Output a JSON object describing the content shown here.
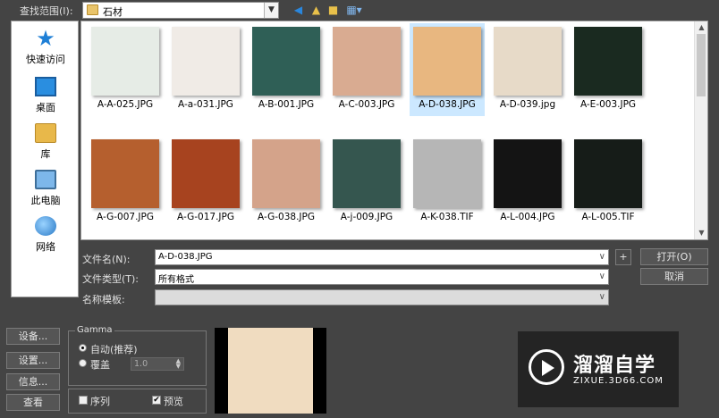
{
  "toolbar": {
    "lookin_label": "查找范围(I):",
    "lookin_value": "石材",
    "icons": [
      "back-icon",
      "up-folder-icon",
      "new-folder-icon",
      "view-menu-icon"
    ]
  },
  "places": [
    {
      "label": "快速访问",
      "icon": "star-icon"
    },
    {
      "label": "桌面",
      "icon": "desktop-icon"
    },
    {
      "label": "库",
      "icon": "library-icon"
    },
    {
      "label": "此电脑",
      "icon": "computer-icon"
    },
    {
      "label": "网络",
      "icon": "network-icon"
    }
  ],
  "files": [
    {
      "name": "A-A-025.JPG",
      "color": "#e6ece6",
      "selected": false
    },
    {
      "name": "A-a-031.JPG",
      "color": "#f0ebe6",
      "selected": false
    },
    {
      "name": "A-B-001.JPG",
      "color": "#2f5f56",
      "selected": false
    },
    {
      "name": "A-C-003.JPG",
      "color": "#d9ab91",
      "selected": false
    },
    {
      "name": "A-D-038.JPG",
      "color": "#e8b780",
      "selected": true
    },
    {
      "name": "A-D-039.jpg",
      "color": "#e7dac8",
      "selected": false
    },
    {
      "name": "A-E-003.JPG",
      "color": "#1a2a20",
      "selected": false
    },
    {
      "name": "A-G-007.JPG",
      "color": "#b55f2e",
      "selected": false
    },
    {
      "name": "A-G-017.JPG",
      "color": "#a7431f",
      "selected": false
    },
    {
      "name": "A-G-038.JPG",
      "color": "#d4a38a",
      "selected": false
    },
    {
      "name": "A-j-009.JPG",
      "color": "#35564f",
      "selected": false
    },
    {
      "name": "A-K-038.TIF",
      "color": "#b6b6b6",
      "selected": false
    },
    {
      "name": "A-L-004.JPG",
      "color": "#141414",
      "selected": false
    },
    {
      "name": "A-L-005.TIF",
      "color": "#161c18",
      "selected": false
    }
  ],
  "form": {
    "filename_label": "文件名(N):",
    "filename_value": "A-D-038.JPG",
    "filetype_label": "文件类型(T):",
    "filetype_value": "所有格式",
    "template_label": "名称模板:",
    "template_value": "",
    "plus_label": "+",
    "open_label": "打开(O)",
    "cancel_label": "取消"
  },
  "side_buttons": {
    "setup": "设备...",
    "settings": "设置...",
    "info": "信息...",
    "view": "查看"
  },
  "gamma": {
    "title": "Gamma",
    "auto_label": "自动(推荐)",
    "override_label": "覆盖",
    "override_value": "1.0",
    "auto_selected": true
  },
  "options": {
    "sequence_label": "序列",
    "sequence_checked": false,
    "preview_label": "预览",
    "preview_checked": true
  },
  "preview": {
    "color": "#f0dcc0"
  },
  "watermark": {
    "title": "溜溜自学",
    "url": "ZIXUE.3D66.COM"
  }
}
